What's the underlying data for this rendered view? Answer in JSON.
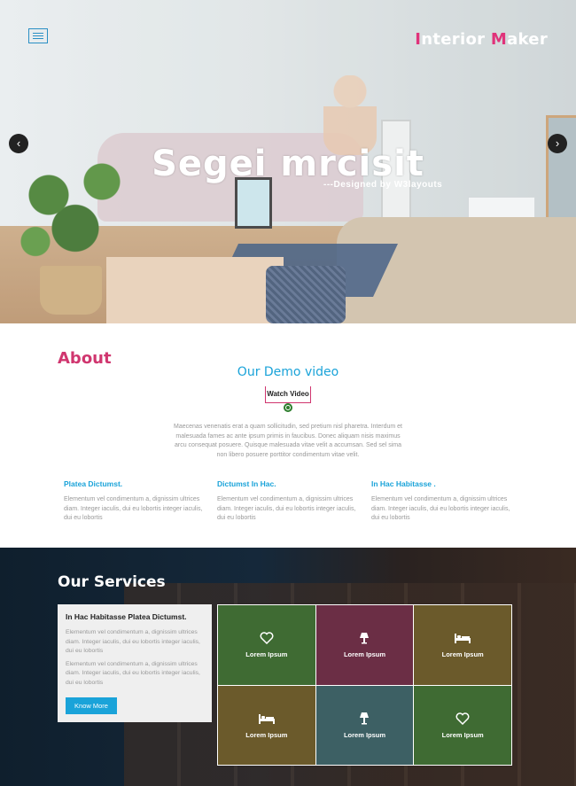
{
  "header": {
    "logo_first_letter": "I",
    "logo_rest_1": "nterior ",
    "logo_second_letter": "M",
    "logo_rest_2": "aker",
    "accent_color": "#e0327a"
  },
  "hero": {
    "title": "Segei mrcisit",
    "subtitle": "---Designed by W3layouts",
    "prev_arrow": "‹",
    "next_arrow": "›"
  },
  "about": {
    "title": "About",
    "demo_title": "Our Demo video",
    "watch_button": "Watch Video",
    "text": "Maecenas venenatis erat a quam sollicitudin, sed pretium nisl pharetra. Interdum et malesuada fames ac ante ipsum primis in faucibus. Donec aliquam nisis maximus arcu consequat posuere. Quisque malesuada vitae velit a accumsan. Sed sel sima non libero posuere porttitor condimentum vitae velit.",
    "columns": [
      {
        "title": "Platea Dictumst.",
        "text": "Elementum vel condimentum a, dignissim ultrices diam. Integer iaculis, dui eu lobortis integer iaculis, dui eu lobortis"
      },
      {
        "title": "Dictumst In Hac.",
        "text": "Elementum vel condimentum a, dignissim ultrices diam. Integer iaculis, dui eu lobortis integer iaculis, dui eu lobortis"
      },
      {
        "title": "In Hac Habitasse .",
        "text": "Elementum vel condimentum a, dignissim ultrices diam. Integer iaculis, dui eu lobortis integer iaculis, dui eu lobortis"
      }
    ]
  },
  "services": {
    "title": "Our Services",
    "box_title": "In Hac Habitasse Platea Dictumst.",
    "box_text_1": "Elementum vel condimentum a, dignissim ultrices diam. Integer iaculis, dui eu lobortis integer iaculis, dui eu lobortis",
    "box_text_2": "Elementum vel condimentum a, dignissim ultrices diam. Integer iaculis, dui eu lobortis integer iaculis, dui eu lobortis",
    "know_more": "Know More",
    "tiles": [
      {
        "label": "Lorem Ipsum",
        "icon": "heart-icon",
        "color": "#3f6b33"
      },
      {
        "label": "Lorem Ipsum",
        "icon": "lamp-icon",
        "color": "#6b2e45"
      },
      {
        "label": "Lorem Ipsum",
        "icon": "bed-icon",
        "color": "#6b5a2b"
      },
      {
        "label": "Lorem Ipsum",
        "icon": "bed-icon",
        "color": "#6b5a2b"
      },
      {
        "label": "Lorem Ipsum",
        "icon": "lamp-icon",
        "color": "#3d6064"
      },
      {
        "label": "Lorem Ipsum",
        "icon": "heart-icon",
        "color": "#3f6b33"
      }
    ]
  }
}
